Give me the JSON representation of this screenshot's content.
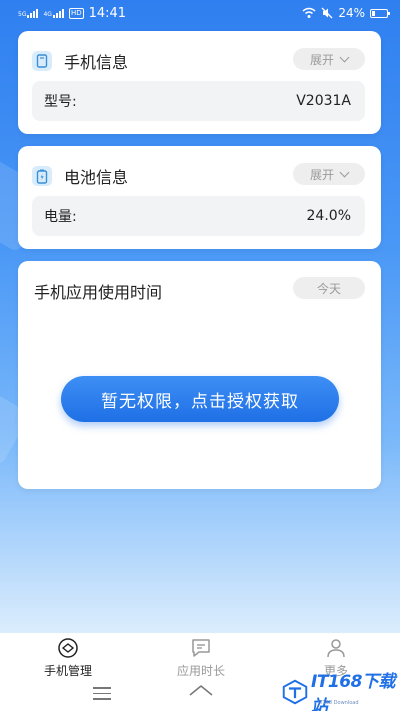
{
  "status_bar": {
    "sim1_tag": "5G",
    "sim2_tag": "4G",
    "hd_tag": "HD",
    "time": "14:41",
    "battery_text": "24%",
    "battery_level": 0.24
  },
  "phone_info": {
    "title": "手机信息",
    "toggle_label": "展开",
    "model_label": "型号:",
    "model_value": "V2031A"
  },
  "battery_info": {
    "title": "电池信息",
    "toggle_label": "展开",
    "level_label": "电量:",
    "level_value": "24.0%"
  },
  "app_usage": {
    "title": "手机应用使用时间",
    "period_label": "今天",
    "grant_button_label": "暂无权限，点击授权获取"
  },
  "bottom_nav": {
    "items": [
      {
        "label": "手机管理",
        "icon": "phone-manage-icon",
        "active": true
      },
      {
        "label": "应用时长",
        "icon": "app-duration-icon",
        "active": false
      },
      {
        "label": "更多",
        "icon": "more-person-icon",
        "active": false
      }
    ]
  },
  "watermark": {
    "text": "IT168下载站",
    "subtext": "IT168 Download"
  },
  "colors": {
    "accent": "#1f6fe6",
    "background_top": "#2f7ff0",
    "nav_inactive": "#9a9a9a"
  }
}
